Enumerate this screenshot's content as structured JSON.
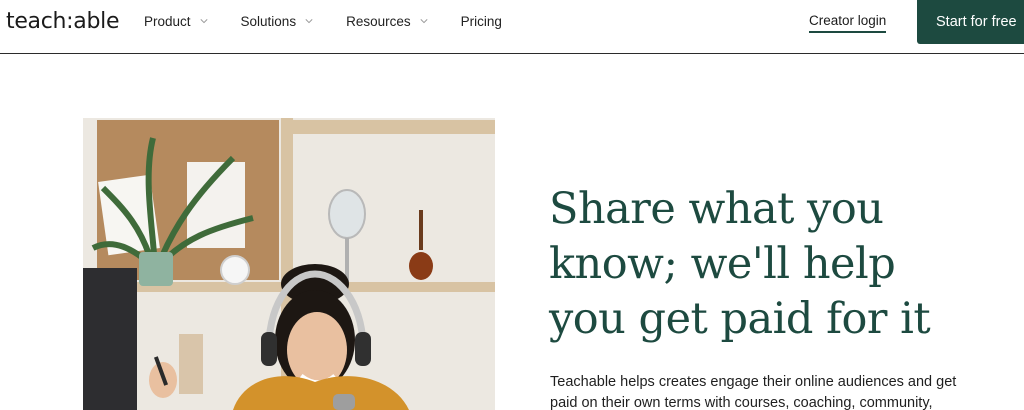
{
  "header": {
    "logo": "teach:able",
    "nav": [
      {
        "label": "Product",
        "has_dropdown": true
      },
      {
        "label": "Solutions",
        "has_dropdown": true
      },
      {
        "label": "Resources",
        "has_dropdown": true
      },
      {
        "label": "Pricing",
        "has_dropdown": false
      }
    ],
    "creator_login": "Creator login",
    "cta": "Start for free"
  },
  "hero": {
    "title": "Share what you know; we'll help you get paid for it",
    "subtitle": "Teachable helps creates engage their online audiences and get paid on their own terms with courses, coaching, community,"
  },
  "colors": {
    "brand_green": "#1d4a40",
    "text_dark": "#1f1f1f"
  },
  "icons": {
    "dropdown": "chevron-down-icon"
  }
}
